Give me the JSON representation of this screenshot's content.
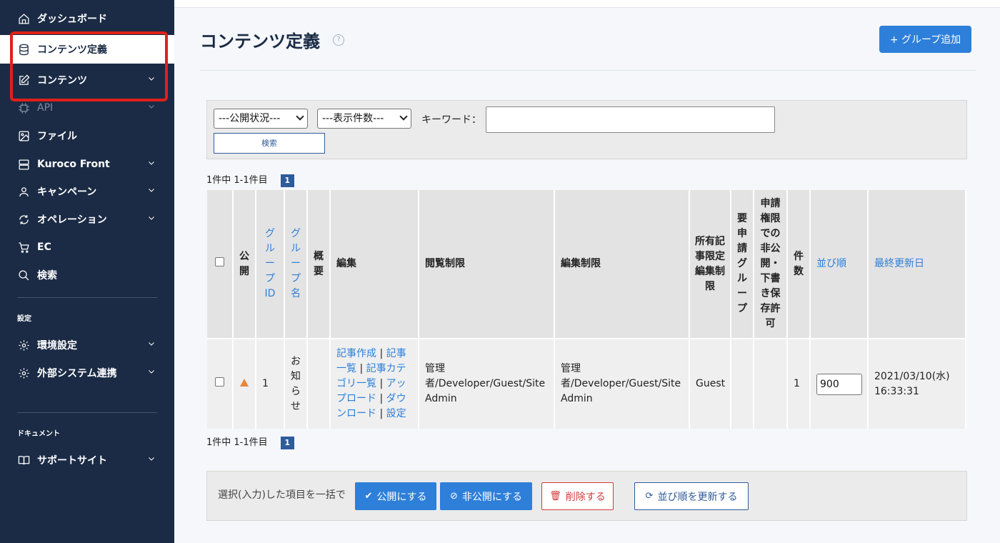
{
  "sidebar": {
    "items": [
      {
        "label": "ダッシュボード",
        "icon": "home-icon"
      },
      {
        "label": "コンテンツ定義",
        "icon": "database-icon"
      },
      {
        "label": "コンテンツ",
        "icon": "edit-icon"
      },
      {
        "label": "API",
        "icon": "chip-icon"
      },
      {
        "label": "ファイル",
        "icon": "image-icon"
      },
      {
        "label": "Kuroco Front",
        "icon": "server-icon"
      },
      {
        "label": "キャンペーン",
        "icon": "user-icon"
      },
      {
        "label": "オペレーション",
        "icon": "refresh-icon"
      },
      {
        "label": "EC",
        "icon": "cart-icon"
      },
      {
        "label": "検索",
        "icon": "search-icon"
      },
      {
        "label": "環境設定",
        "icon": "gear-icon"
      },
      {
        "label": "外部システム連携",
        "icon": "gear-icon"
      },
      {
        "label": "サポートサイト",
        "icon": "book-icon"
      }
    ],
    "section_settings": "設定",
    "section_docs": "ドキュメント"
  },
  "header": {
    "title": "コンテンツ定義",
    "help_icon": "?",
    "add_group_label": "+ グループ追加"
  },
  "filter": {
    "status_select": "---公開状況---",
    "count_select": "---表示件数---",
    "keyword_label": "キーワード：",
    "keyword_value": "",
    "search_label": "検索"
  },
  "pager": {
    "summary": "1件中 1-1件目",
    "page": "1"
  },
  "table": {
    "headers": {
      "public": "公開",
      "group_id": "グループID",
      "group_name": "グループ名",
      "summary": "概要",
      "edit": "編集",
      "view_limit": "閲覧制限",
      "edit_limit": "編集制限",
      "owner_limit": "所有記事限定編集制限",
      "approval_group": "要申請グループ",
      "approval_perm": "申請権限での非公開・下書き保存許可",
      "count": "件数",
      "order": "並び順",
      "updated": "最終更新日"
    },
    "row": {
      "group_id": "1",
      "group_name": "お知らせ",
      "links": [
        "記事作成",
        "記事一覧",
        "記事カテゴリ一覧",
        "アップロード",
        "ダウンロード",
        "設定"
      ],
      "view_limit": "管理者/Developer/Guest/Site Admin",
      "edit_limit": "管理者/Developer/Guest/Site Admin",
      "owner_limit": "Guest",
      "approval_group": "",
      "approval_perm": "",
      "count": "1",
      "order": "900",
      "updated_date": "2021/03/10(水)",
      "updated_time": "16:33:31"
    }
  },
  "bulk": {
    "label": "選択(入力)した項目を一括で",
    "publish": "公開にする",
    "unpublish": "非公開にする",
    "delete": "削除する",
    "update_order": "並び順を更新する"
  },
  "colors": {
    "sidebar_bg": "#1b2b45",
    "accent": "#2e7fd9",
    "highlight": "#e0201a",
    "danger": "#d33a3a"
  }
}
